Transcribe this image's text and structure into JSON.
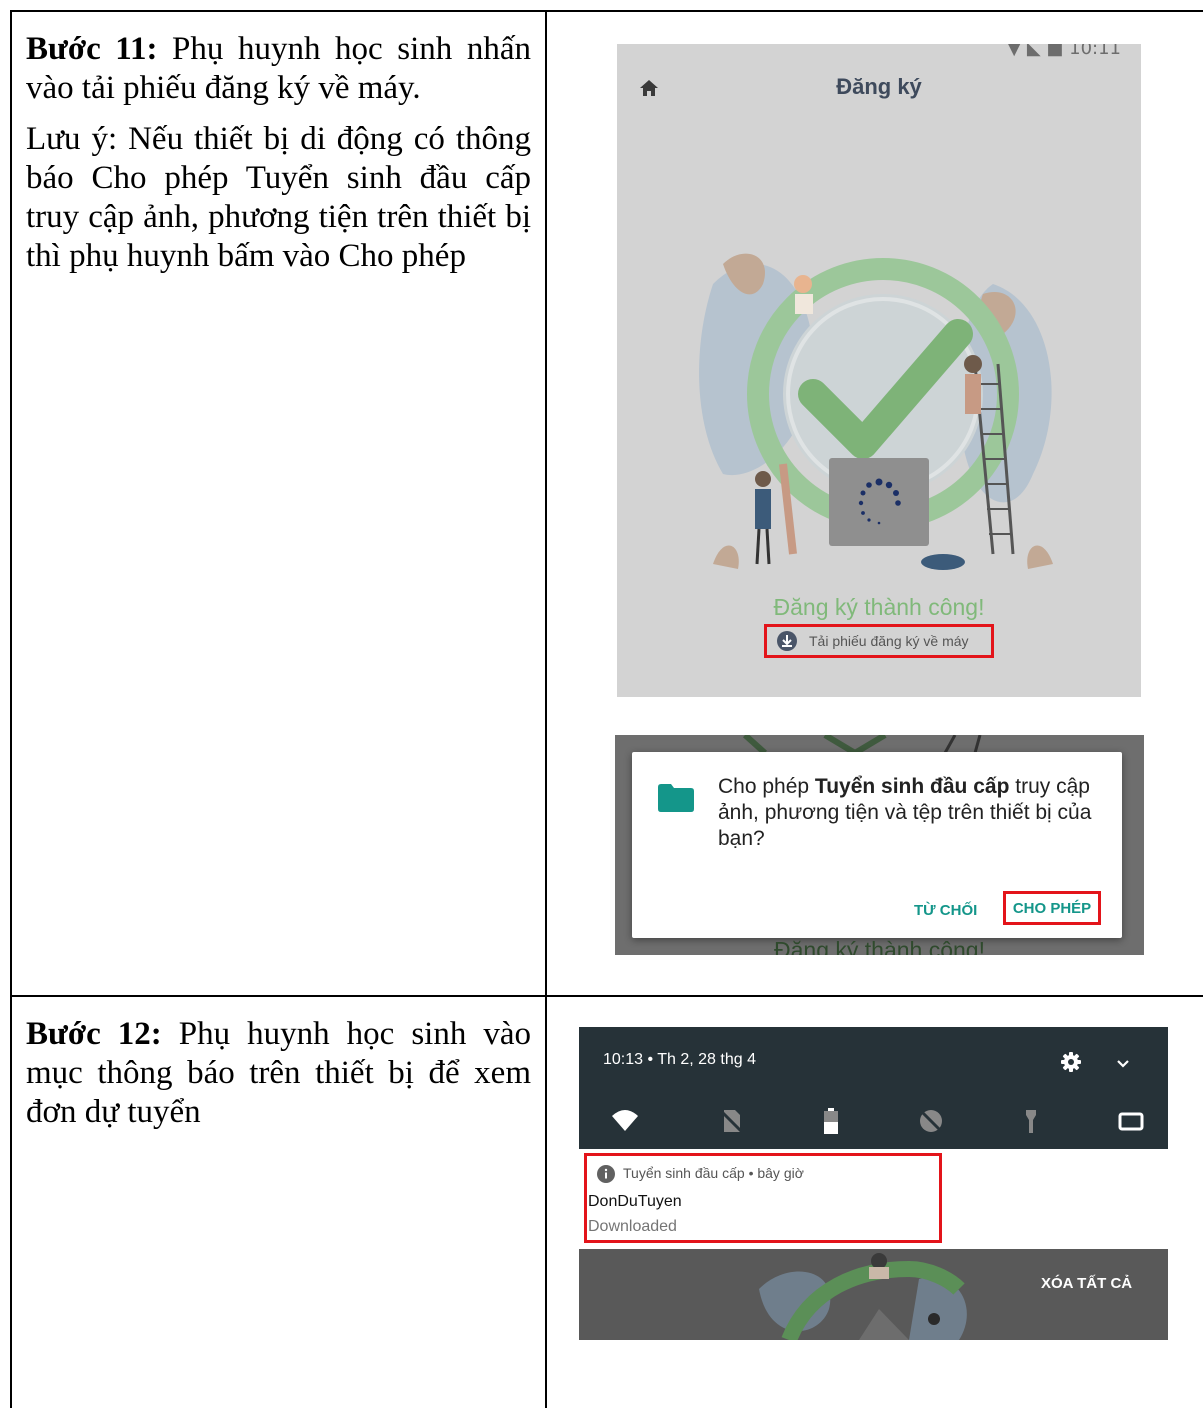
{
  "step11": {
    "label": "Bước 11:",
    "text": " Phụ huynh học sinh nhấn vào tải phiếu đăng ký về máy.",
    "note": "Lưu ý: Nếu thiết bị di động có thông báo Cho phép Tuyển sinh đầu cấp truy cập ảnh, phương tiện trên thiết bị thì phụ huynh bấm vào Cho phép"
  },
  "step12": {
    "label": "Bước 12:",
    "text": " Phụ huynh học sinh vào mục thông báo trên thiết bị để xem đơn dự tuyển"
  },
  "screen1": {
    "status_time": "10:11",
    "title": "Đăng ký",
    "success_text": "Đăng ký thành công!",
    "download_label": "Tải phiếu đăng ký về máy"
  },
  "dialog": {
    "message_prefix": "Cho phép ",
    "app_name": "Tuyển sinh đầu cấp",
    "message_suffix": " truy cập ảnh, phương tiện và tệp trên thiết bị của bạn?",
    "deny_label": "TỪ CHỐI",
    "allow_label": "CHO PHÉP",
    "background_text": "Đăng ký thành công!"
  },
  "notification_shade": {
    "time_date": "10:13 • Th 2, 28 thg 4",
    "notification": {
      "app_line": "Tuyển sinh đầu cấp • bây giờ",
      "title": "DonDuTuyen",
      "body": "Downloaded"
    },
    "clear_all_label": "XÓA TẤT CẢ"
  },
  "colors": {
    "highlight_red": "#e3141a",
    "teal_accent": "#14968a",
    "success_green": "#80b97a",
    "shade_dark": "#263238"
  },
  "icons": [
    "home-icon",
    "download-icon",
    "folder-icon",
    "gear-icon",
    "chevron-down-icon",
    "wifi-icon",
    "no-sim-icon",
    "battery-icon",
    "do-not-disturb-icon",
    "flashlight-icon",
    "cast-icon",
    "info-icon"
  ]
}
